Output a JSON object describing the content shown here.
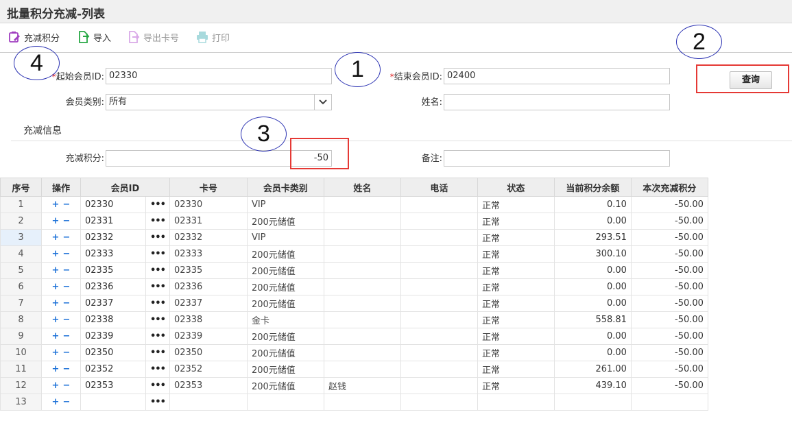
{
  "header": {
    "title": "批量积分充减-列表"
  },
  "toolbar": [
    {
      "label": "充减积分",
      "icon": "points-edit-icon"
    },
    {
      "label": "导入",
      "icon": "import-icon"
    },
    {
      "label": "导出卡号",
      "icon": "export-icon"
    },
    {
      "label": "打印",
      "icon": "print-icon"
    }
  ],
  "form": {
    "start_id_label": "起始会员ID:",
    "start_id_value": "02330",
    "end_id_label": "结束会员ID:",
    "end_id_value": "02400",
    "member_type_label": "会员类别:",
    "member_type_value": "所有",
    "name_label": "姓名:",
    "name_value": "",
    "query_label": "查询",
    "section_title": "充减信息",
    "points_label": "充减积分:",
    "points_value": "-50",
    "remark_label": "备注:",
    "remark_value": "",
    "required_mark": "*"
  },
  "annotations": [
    "1",
    "2",
    "3",
    "4"
  ],
  "colors": {
    "accent": "#1e72d8",
    "highlight": "#e53935",
    "annotation": "#2b32b2"
  },
  "table": {
    "headers": [
      "序号",
      "操作",
      "会员ID",
      "卡号",
      "会员卡类别",
      "姓名",
      "电话",
      "状态",
      "当前积分余额",
      "本次充减积分"
    ],
    "op_add": "+",
    "op_remove": "−",
    "lookup_icon": "•••",
    "rows": [
      {
        "no": "1",
        "id": "02330",
        "card": "02330",
        "type": "VIP",
        "name": "",
        "phone": "",
        "status": "正常",
        "balance": "0.10",
        "change": "-50.00"
      },
      {
        "no": "2",
        "id": "02331",
        "card": "02331",
        "type": "200元储值",
        "name": "",
        "phone": "",
        "status": "正常",
        "balance": "0.00",
        "change": "-50.00"
      },
      {
        "no": "3",
        "id": "02332",
        "card": "02332",
        "type": "VIP",
        "name": "",
        "phone": "",
        "status": "正常",
        "balance": "293.51",
        "change": "-50.00"
      },
      {
        "no": "4",
        "id": "02333",
        "card": "02333",
        "type": "200元储值",
        "name": "",
        "phone": "",
        "status": "正常",
        "balance": "300.10",
        "change": "-50.00"
      },
      {
        "no": "5",
        "id": "02335",
        "card": "02335",
        "type": "200元储值",
        "name": "",
        "phone": "",
        "status": "正常",
        "balance": "0.00",
        "change": "-50.00"
      },
      {
        "no": "6",
        "id": "02336",
        "card": "02336",
        "type": "200元储值",
        "name": "",
        "phone": "",
        "status": "正常",
        "balance": "0.00",
        "change": "-50.00"
      },
      {
        "no": "7",
        "id": "02337",
        "card": "02337",
        "type": "200元储值",
        "name": "",
        "phone": "",
        "status": "正常",
        "balance": "0.00",
        "change": "-50.00"
      },
      {
        "no": "8",
        "id": "02338",
        "card": "02338",
        "type": "金卡",
        "name": "",
        "phone": "",
        "status": "正常",
        "balance": "558.81",
        "change": "-50.00"
      },
      {
        "no": "9",
        "id": "02339",
        "card": "02339",
        "type": "200元储值",
        "name": "",
        "phone": "",
        "status": "正常",
        "balance": "0.00",
        "change": "-50.00"
      },
      {
        "no": "10",
        "id": "02350",
        "card": "02350",
        "type": "200元储值",
        "name": "",
        "phone": "",
        "status": "正常",
        "balance": "0.00",
        "change": "-50.00"
      },
      {
        "no": "11",
        "id": "02352",
        "card": "02352",
        "type": "200元储值",
        "name": "",
        "phone": "",
        "status": "正常",
        "balance": "261.00",
        "change": "-50.00"
      },
      {
        "no": "12",
        "id": "02353",
        "card": "02353",
        "type": "200元储值",
        "name": "赵钱",
        "phone": "",
        "status": "正常",
        "balance": "439.10",
        "change": "-50.00"
      },
      {
        "no": "13",
        "id": "",
        "card": "",
        "type": "",
        "name": "",
        "phone": "",
        "status": "",
        "balance": "",
        "change": ""
      }
    ]
  }
}
